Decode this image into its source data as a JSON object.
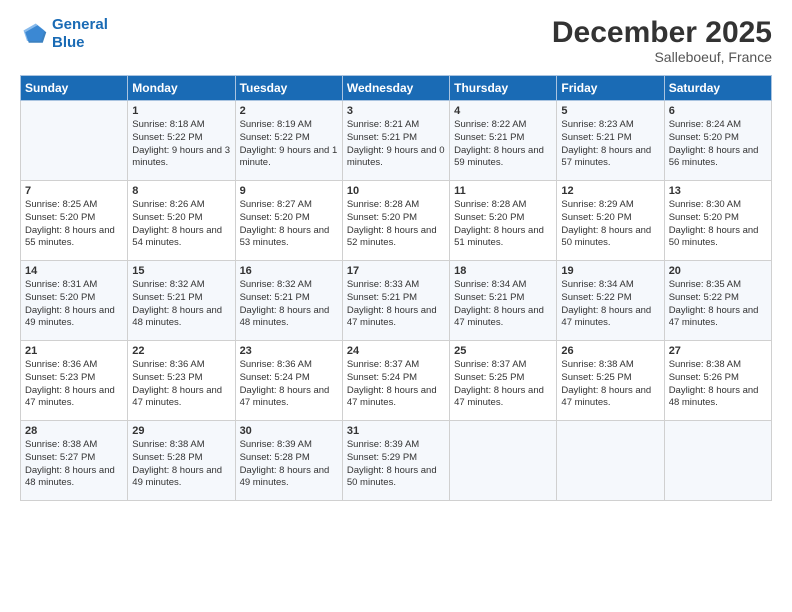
{
  "header": {
    "logo_line1": "General",
    "logo_line2": "Blue",
    "month_title": "December 2025",
    "subtitle": "Salleboeuf, France"
  },
  "days_of_week": [
    "Sunday",
    "Monday",
    "Tuesday",
    "Wednesday",
    "Thursday",
    "Friday",
    "Saturday"
  ],
  "weeks": [
    [
      {
        "day": "",
        "sunrise": "",
        "sunset": "",
        "daylight": ""
      },
      {
        "day": "1",
        "sunrise": "Sunrise: 8:18 AM",
        "sunset": "Sunset: 5:22 PM",
        "daylight": "Daylight: 9 hours and 3 minutes."
      },
      {
        "day": "2",
        "sunrise": "Sunrise: 8:19 AM",
        "sunset": "Sunset: 5:22 PM",
        "daylight": "Daylight: 9 hours and 1 minute."
      },
      {
        "day": "3",
        "sunrise": "Sunrise: 8:21 AM",
        "sunset": "Sunset: 5:21 PM",
        "daylight": "Daylight: 9 hours and 0 minutes."
      },
      {
        "day": "4",
        "sunrise": "Sunrise: 8:22 AM",
        "sunset": "Sunset: 5:21 PM",
        "daylight": "Daylight: 8 hours and 59 minutes."
      },
      {
        "day": "5",
        "sunrise": "Sunrise: 8:23 AM",
        "sunset": "Sunset: 5:21 PM",
        "daylight": "Daylight: 8 hours and 57 minutes."
      },
      {
        "day": "6",
        "sunrise": "Sunrise: 8:24 AM",
        "sunset": "Sunset: 5:20 PM",
        "daylight": "Daylight: 8 hours and 56 minutes."
      }
    ],
    [
      {
        "day": "7",
        "sunrise": "Sunrise: 8:25 AM",
        "sunset": "Sunset: 5:20 PM",
        "daylight": "Daylight: 8 hours and 55 minutes."
      },
      {
        "day": "8",
        "sunrise": "Sunrise: 8:26 AM",
        "sunset": "Sunset: 5:20 PM",
        "daylight": "Daylight: 8 hours and 54 minutes."
      },
      {
        "day": "9",
        "sunrise": "Sunrise: 8:27 AM",
        "sunset": "Sunset: 5:20 PM",
        "daylight": "Daylight: 8 hours and 53 minutes."
      },
      {
        "day": "10",
        "sunrise": "Sunrise: 8:28 AM",
        "sunset": "Sunset: 5:20 PM",
        "daylight": "Daylight: 8 hours and 52 minutes."
      },
      {
        "day": "11",
        "sunrise": "Sunrise: 8:28 AM",
        "sunset": "Sunset: 5:20 PM",
        "daylight": "Daylight: 8 hours and 51 minutes."
      },
      {
        "day": "12",
        "sunrise": "Sunrise: 8:29 AM",
        "sunset": "Sunset: 5:20 PM",
        "daylight": "Daylight: 8 hours and 50 minutes."
      },
      {
        "day": "13",
        "sunrise": "Sunrise: 8:30 AM",
        "sunset": "Sunset: 5:20 PM",
        "daylight": "Daylight: 8 hours and 50 minutes."
      }
    ],
    [
      {
        "day": "14",
        "sunrise": "Sunrise: 8:31 AM",
        "sunset": "Sunset: 5:20 PM",
        "daylight": "Daylight: 8 hours and 49 minutes."
      },
      {
        "day": "15",
        "sunrise": "Sunrise: 8:32 AM",
        "sunset": "Sunset: 5:21 PM",
        "daylight": "Daylight: 8 hours and 48 minutes."
      },
      {
        "day": "16",
        "sunrise": "Sunrise: 8:32 AM",
        "sunset": "Sunset: 5:21 PM",
        "daylight": "Daylight: 8 hours and 48 minutes."
      },
      {
        "day": "17",
        "sunrise": "Sunrise: 8:33 AM",
        "sunset": "Sunset: 5:21 PM",
        "daylight": "Daylight: 8 hours and 47 minutes."
      },
      {
        "day": "18",
        "sunrise": "Sunrise: 8:34 AM",
        "sunset": "Sunset: 5:21 PM",
        "daylight": "Daylight: 8 hours and 47 minutes."
      },
      {
        "day": "19",
        "sunrise": "Sunrise: 8:34 AM",
        "sunset": "Sunset: 5:22 PM",
        "daylight": "Daylight: 8 hours and 47 minutes."
      },
      {
        "day": "20",
        "sunrise": "Sunrise: 8:35 AM",
        "sunset": "Sunset: 5:22 PM",
        "daylight": "Daylight: 8 hours and 47 minutes."
      }
    ],
    [
      {
        "day": "21",
        "sunrise": "Sunrise: 8:36 AM",
        "sunset": "Sunset: 5:23 PM",
        "daylight": "Daylight: 8 hours and 47 minutes."
      },
      {
        "day": "22",
        "sunrise": "Sunrise: 8:36 AM",
        "sunset": "Sunset: 5:23 PM",
        "daylight": "Daylight: 8 hours and 47 minutes."
      },
      {
        "day": "23",
        "sunrise": "Sunrise: 8:36 AM",
        "sunset": "Sunset: 5:24 PM",
        "daylight": "Daylight: 8 hours and 47 minutes."
      },
      {
        "day": "24",
        "sunrise": "Sunrise: 8:37 AM",
        "sunset": "Sunset: 5:24 PM",
        "daylight": "Daylight: 8 hours and 47 minutes."
      },
      {
        "day": "25",
        "sunrise": "Sunrise: 8:37 AM",
        "sunset": "Sunset: 5:25 PM",
        "daylight": "Daylight: 8 hours and 47 minutes."
      },
      {
        "day": "26",
        "sunrise": "Sunrise: 8:38 AM",
        "sunset": "Sunset: 5:25 PM",
        "daylight": "Daylight: 8 hours and 47 minutes."
      },
      {
        "day": "27",
        "sunrise": "Sunrise: 8:38 AM",
        "sunset": "Sunset: 5:26 PM",
        "daylight": "Daylight: 8 hours and 48 minutes."
      }
    ],
    [
      {
        "day": "28",
        "sunrise": "Sunrise: 8:38 AM",
        "sunset": "Sunset: 5:27 PM",
        "daylight": "Daylight: 8 hours and 48 minutes."
      },
      {
        "day": "29",
        "sunrise": "Sunrise: 8:38 AM",
        "sunset": "Sunset: 5:28 PM",
        "daylight": "Daylight: 8 hours and 49 minutes."
      },
      {
        "day": "30",
        "sunrise": "Sunrise: 8:39 AM",
        "sunset": "Sunset: 5:28 PM",
        "daylight": "Daylight: 8 hours and 49 minutes."
      },
      {
        "day": "31",
        "sunrise": "Sunrise: 8:39 AM",
        "sunset": "Sunset: 5:29 PM",
        "daylight": "Daylight: 8 hours and 50 minutes."
      },
      {
        "day": "",
        "sunrise": "",
        "sunset": "",
        "daylight": ""
      },
      {
        "day": "",
        "sunrise": "",
        "sunset": "",
        "daylight": ""
      },
      {
        "day": "",
        "sunrise": "",
        "sunset": "",
        "daylight": ""
      }
    ]
  ]
}
